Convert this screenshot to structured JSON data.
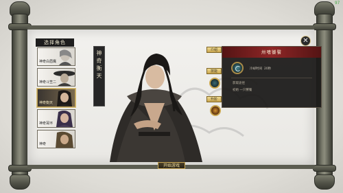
{
  "fps": "97",
  "panel": {
    "title": "选择角色"
  },
  "characters": [
    {
      "name": "神奇白眉鹰",
      "selected": false
    },
    {
      "name": "神奇斗笠二",
      "selected": false
    },
    {
      "name": "神奇衡天",
      "selected": true
    },
    {
      "name": "神奇耳环",
      "selected": false
    },
    {
      "name": "神奇",
      "selected": false
    }
  ],
  "hero": {
    "name_chars": [
      "神",
      "奇",
      "衡",
      "天"
    ]
  },
  "side_buttons": [
    {
      "label": "介绍"
    },
    {
      "label": "技能"
    },
    {
      "label": "升阶"
    }
  ],
  "tooltip": {
    "title": "卅嗜饕餮",
    "cooldown_label": "冷却时间",
    "cooldown_value": "20秒",
    "condition_label": "获取途径",
    "condition_value": "初始 一只饕餮"
  },
  "start_button": {
    "label": "开始游戏"
  },
  "close_icon": "close-icon",
  "colors": {
    "accent_gold": "#c9a54d",
    "tooltip_header": "#8e2626",
    "fps_green": "#3fa63f"
  }
}
